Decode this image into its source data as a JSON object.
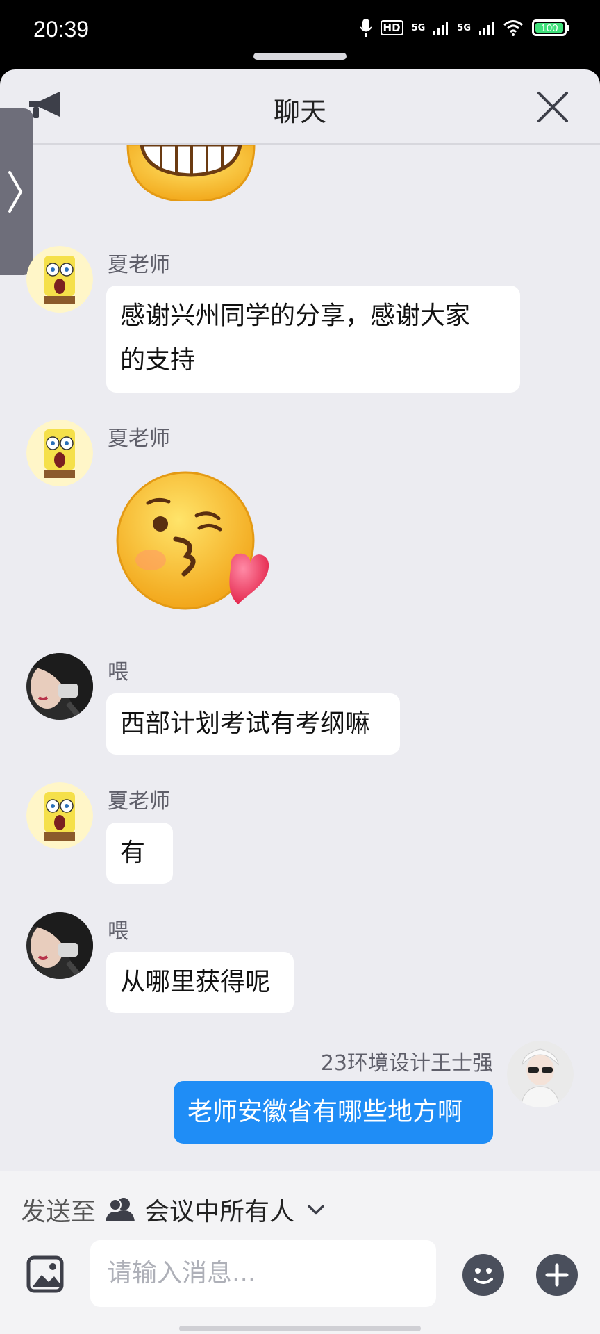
{
  "status_bar": {
    "time": "20:39",
    "battery": "100",
    "network1": "5G",
    "network2": "5G",
    "hd": "HD"
  },
  "header": {
    "title": "聊天"
  },
  "messages": [
    {
      "sender": "夏老师",
      "type": "text",
      "text": "感谢兴州同学的分享，感谢大家",
      "text2": "的支持"
    },
    {
      "sender": "夏老师",
      "type": "emoji",
      "emoji": "kiss-heart"
    },
    {
      "sender": "喂",
      "type": "text",
      "text": "西部计划考试有考纲嘛"
    },
    {
      "sender": "夏老师",
      "type": "text",
      "text": "有"
    },
    {
      "sender": "喂",
      "type": "text",
      "text": "从哪里获得呢"
    },
    {
      "sender": "23环境设计王士强",
      "type": "text",
      "text": "老师安徽省有哪些地方啊",
      "mine": true
    }
  ],
  "composer": {
    "send_to_label": "发送至",
    "send_to_target": "会议中所有人",
    "placeholder": "请输入消息..."
  },
  "colors": {
    "accent": "#1f8df6",
    "sheet_bg": "#ececf1",
    "battery": "#3ee07a"
  }
}
